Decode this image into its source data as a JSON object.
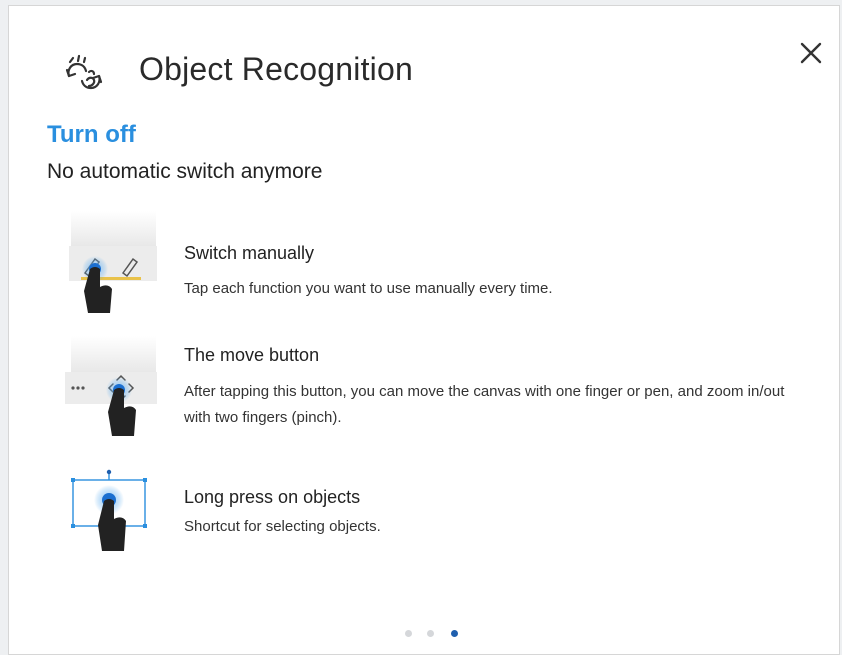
{
  "dialog": {
    "title": "Object Recognition",
    "header_icon": "object-recognition-icon",
    "close_icon": "close-icon"
  },
  "status": {
    "title": "Turn off",
    "description": "No automatic switch anymore"
  },
  "items": [
    {
      "icon": "switch-manually-illustration",
      "title": "Switch manually",
      "description": "Tap each function you want to use manually every time."
    },
    {
      "icon": "move-button-illustration",
      "title": "The move button",
      "description": "After tapping this button, you can move the canvas with one finger or pen, and zoom in/out with two fingers (pinch)."
    },
    {
      "icon": "long-press-illustration",
      "title": "Long press on objects",
      "description": "Shortcut for selecting objects."
    }
  ],
  "pagination": {
    "pages": 3,
    "current": 3
  },
  "colors": {
    "accent": "#2a8fdf",
    "active_dot": "#1f5fae",
    "inactive_dot": "#d5d7da",
    "hand": "#222222",
    "touch_glow": "#3a9bea"
  }
}
